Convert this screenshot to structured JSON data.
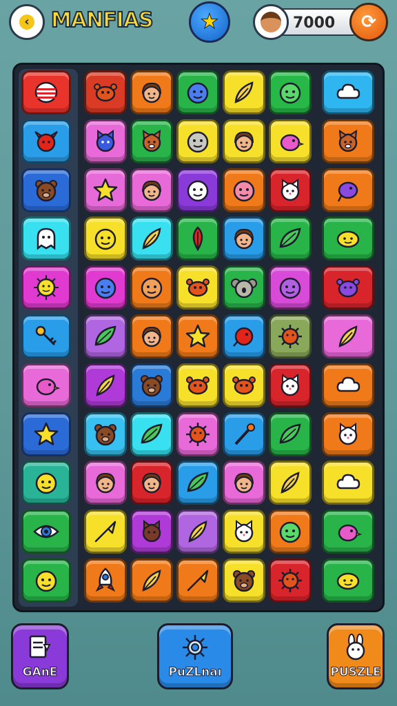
{
  "header": {
    "title": "MANFIAS",
    "coins_value": "7000",
    "back_icon": "chevron-left-icon",
    "star_icon": "star-icon",
    "refresh_icon": "refresh-icon"
  },
  "board": {
    "columns": 8,
    "rows": 11,
    "tiles": [
      [
        "#e8342b",
        "cake",
        "#d93b24",
        "crab",
        "#f07a1a",
        "girl",
        "#29b44a",
        "blue-face",
        "#f7e02a",
        "feather",
        "#28b848",
        "green-face",
        "#2fb6f0",
        "cloud"
      ],
      [
        "#2a9de8",
        "red-bull",
        "#e86ad8",
        "blue-cat",
        "#29b44a",
        "fox",
        "#f7e02a",
        "gray-face",
        "#f7e02a",
        "girl",
        "#f7e02a",
        "pink-bird",
        "#f07a1a",
        "fox"
      ],
      [
        "#2b6bd8",
        "bear",
        "#e66ad8",
        "star",
        "#e86ad8",
        "girl",
        "#8a3ad8",
        "white-face",
        "#f07a1a",
        "pink-face",
        "#d8242b",
        "white-cat",
        "#f07a1a",
        "purple-bird"
      ],
      [
        "#38e0f0",
        "ghost",
        "#f7e02a",
        "smile",
        "#38e0f0",
        "feather",
        "#29b44a",
        "red-feather",
        "#2a9de8",
        "girl",
        "#29b44a",
        "leaf",
        "#29b44a",
        "lemon"
      ],
      [
        "#e03ad0",
        "sun",
        "#e03ad0",
        "blue-face",
        "#f07a1a",
        "orange-face",
        "#f7e02a",
        "crab",
        "#29b44a",
        "koala",
        "#d84ad8",
        "purple-face",
        "#d8242b",
        "purple-bug"
      ],
      [
        "#2a9de8",
        "key",
        "#b066e0",
        "leaf",
        "#f07a1a",
        "girl",
        "#f07a1a",
        "star",
        "#2a9de8",
        "red-bird",
        "#8aa85a",
        "virus",
        "#e86ad8",
        "feather"
      ],
      [
        "#e86ad8",
        "pink-bird",
        "#b03ad8",
        "feather",
        "#2a7ad8",
        "bear",
        "#f7e02a",
        "crab",
        "#f7e02a",
        "crab",
        "#d8242b",
        "white-cat",
        "#f07a1a",
        "cloud"
      ],
      [
        "#2b6bd8",
        "star",
        "#38c0f0",
        "bear",
        "#38e0f0",
        "leaf",
        "#e86ad8",
        "virus",
        "#2a9de8",
        "wand",
        "#29b44a",
        "leaf",
        "#f07a1a",
        "white-cat"
      ],
      [
        "#29b498",
        "smile",
        "#e86ad8",
        "girl",
        "#d8242b",
        "girl",
        "#2a9de8",
        "leaf",
        "#e86ad8",
        "girl",
        "#f7e02a",
        "feather",
        "#f7e02a",
        "cloud"
      ],
      [
        "#29b44a",
        "eye",
        "#f7e02a",
        "arrow",
        "#b03ad8",
        "cat",
        "#b066e0",
        "feather",
        "#f7e02a",
        "white-cat",
        "#f07a1a",
        "green-face",
        "#29b44a",
        "pink-bird"
      ],
      [
        "#29b44a",
        "smile",
        "#f07a1a",
        "rocket",
        "#f07a1a",
        "feather",
        "#f07a1a",
        "arrow",
        "#f7e02a",
        "bear",
        "#d8242b",
        "virus",
        "#29b44a",
        "lemon"
      ]
    ]
  },
  "footer": {
    "buttons": [
      {
        "label": "GAnE",
        "color": "#8a3ad8",
        "icon": "document-icon"
      },
      {
        "label": "PuZLnaı",
        "color": "#2a8ae8",
        "icon": "sun-icon"
      },
      {
        "label": "PUSZLE",
        "color": "#f08a1a",
        "icon": "bunny-icon"
      }
    ]
  }
}
